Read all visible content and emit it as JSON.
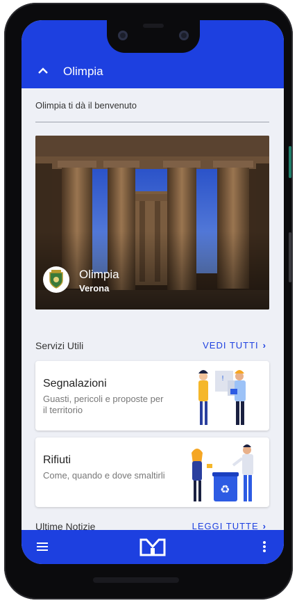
{
  "header": {
    "title": "Olimpia"
  },
  "welcome_text": "Olimpia ti dà il benvenuto",
  "hero": {
    "city": "Olimpia",
    "province": "Verona"
  },
  "services": {
    "title": "Servizi Utili",
    "link_label": "VEDI TUTTI",
    "cards": [
      {
        "title": "Segnalazioni",
        "description": "Guasti, pericoli e proposte per il territorio"
      },
      {
        "title": "Rifiuti",
        "description": "Come, quando e dove smaltirli"
      }
    ]
  },
  "news": {
    "title": "Ultime Notizie",
    "link_label": "LEGGI TUTTE"
  },
  "colors": {
    "primary": "#1d40e0",
    "background": "#eef0f6"
  },
  "icons": [
    "chevron-up-icon",
    "menu-icon",
    "app-logo",
    "more-vert-icon",
    "chevron-right-icon"
  ]
}
